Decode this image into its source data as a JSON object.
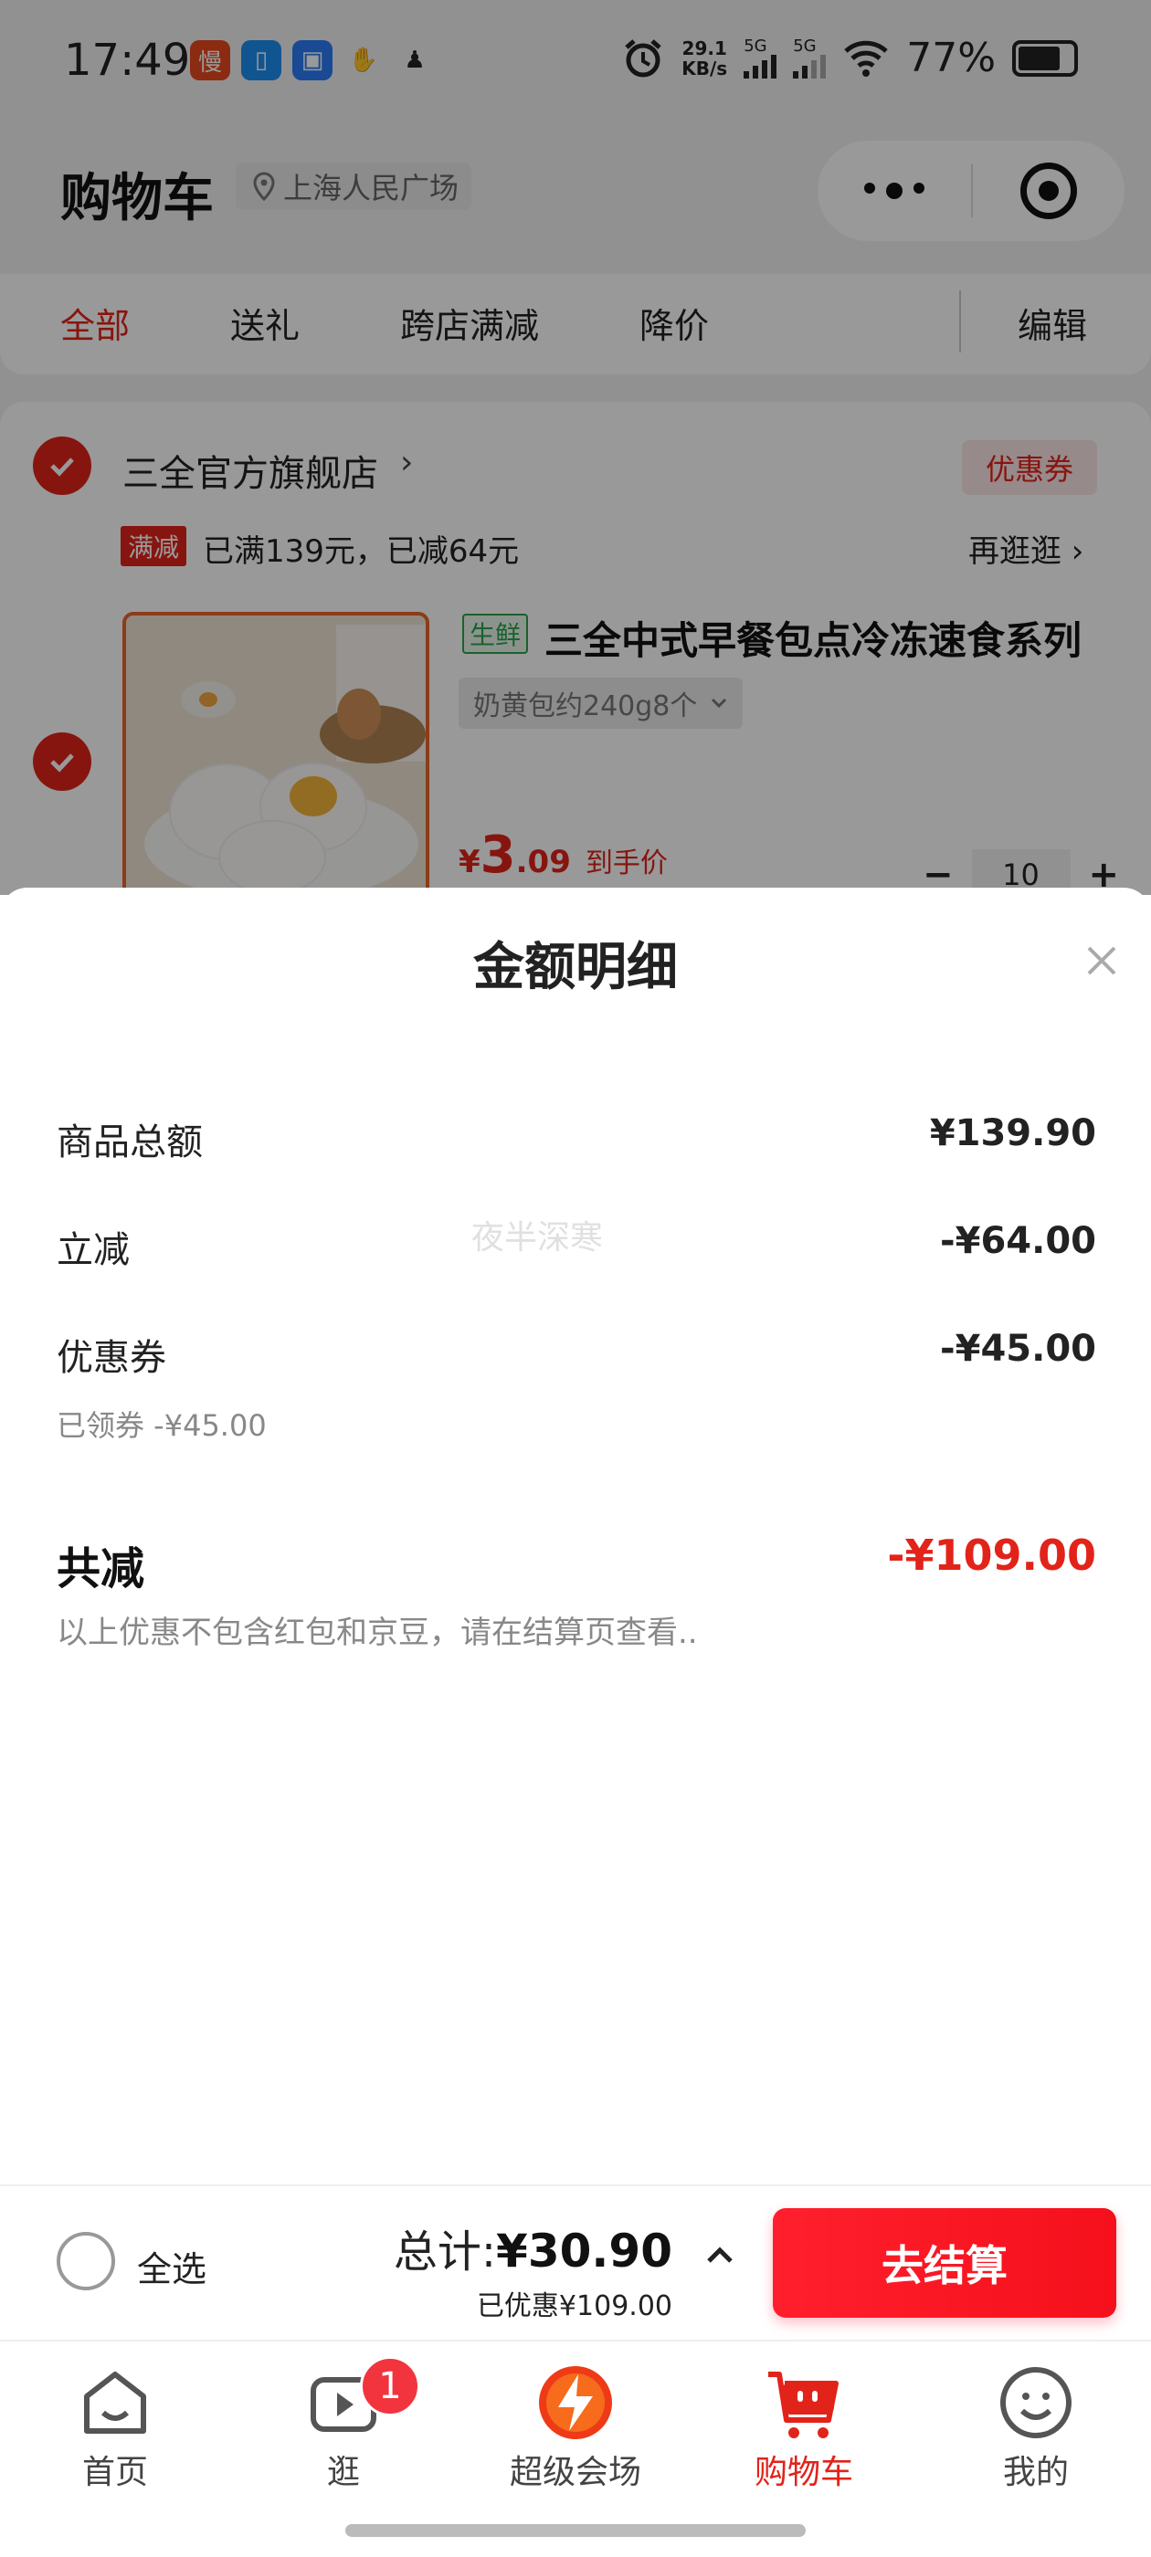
{
  "status_bar": {
    "time": "17:49",
    "net_speed_value": "29.1",
    "net_speed_unit": "KB/s",
    "sim1": "5G",
    "sim2": "5G",
    "battery": "77%",
    "battery_level": 0.77,
    "app_icons": [
      "manman-app-icon",
      "wallet-app-icon",
      "message-app-icon",
      "handshake-app-icon",
      "penguin-app-icon"
    ]
  },
  "header": {
    "title": "购物车",
    "location": "上海人民广场"
  },
  "filter_tabs": [
    {
      "label": "全部",
      "active": true
    },
    {
      "label": "送礼",
      "active": false
    },
    {
      "label": "跨店满减",
      "active": false
    },
    {
      "label": "降价",
      "active": false
    }
  ],
  "edit_label": "编辑",
  "store": {
    "name": "三全官方旗舰店",
    "arrow": "›",
    "coupon_label": "优惠券",
    "promo_tag": "满减",
    "promo_text": "已满139元，已减64元",
    "browse_more": "再逛逛 ›",
    "product": {
      "fresh_tag": "生鲜",
      "name": "三全中式早餐包点冷冻速食系列",
      "sku": "奶黄包约240g8个",
      "price_symbol": "¥",
      "price_int": "3",
      "price_dec": ".09",
      "price_note": "到手价",
      "quantity": "10",
      "minus": "−",
      "plus": "+"
    }
  },
  "sheet": {
    "title": "金额明细",
    "watermark": "夜半深寒",
    "rows": [
      {
        "label": "商品总额",
        "value": "¥139.90"
      },
      {
        "label": "立减",
        "value": "-¥64.00"
      },
      {
        "label": "优惠券",
        "value": "-¥45.00"
      }
    ],
    "coupon_note": "已领券 -¥45.00",
    "total_label": "共减",
    "total_value": "-¥109.00",
    "disclaimer": "以上优惠不包含红包和京豆，请在结算页查看.."
  },
  "checkout": {
    "select_all": "全选",
    "total_prefix": "总计:",
    "total_amount": "¥30.90",
    "saved": "已优惠¥109.00",
    "pay_label": "去结算"
  },
  "tabbar": [
    {
      "label": "首页",
      "icon": "home-icon",
      "active": false
    },
    {
      "label": "逛",
      "icon": "video-icon",
      "active": false,
      "badge": "1"
    },
    {
      "label": "超级会场",
      "icon": "super-venue-icon",
      "active": false
    },
    {
      "label": "购物车",
      "icon": "cart-icon",
      "active": true
    },
    {
      "label": "我的",
      "icon": "profile-icon",
      "active": false
    }
  ],
  "colors": {
    "accent": "#e2231a",
    "overlay": "rgba(0,0,0,0.40)",
    "fresh_green": "#2aa24a"
  }
}
